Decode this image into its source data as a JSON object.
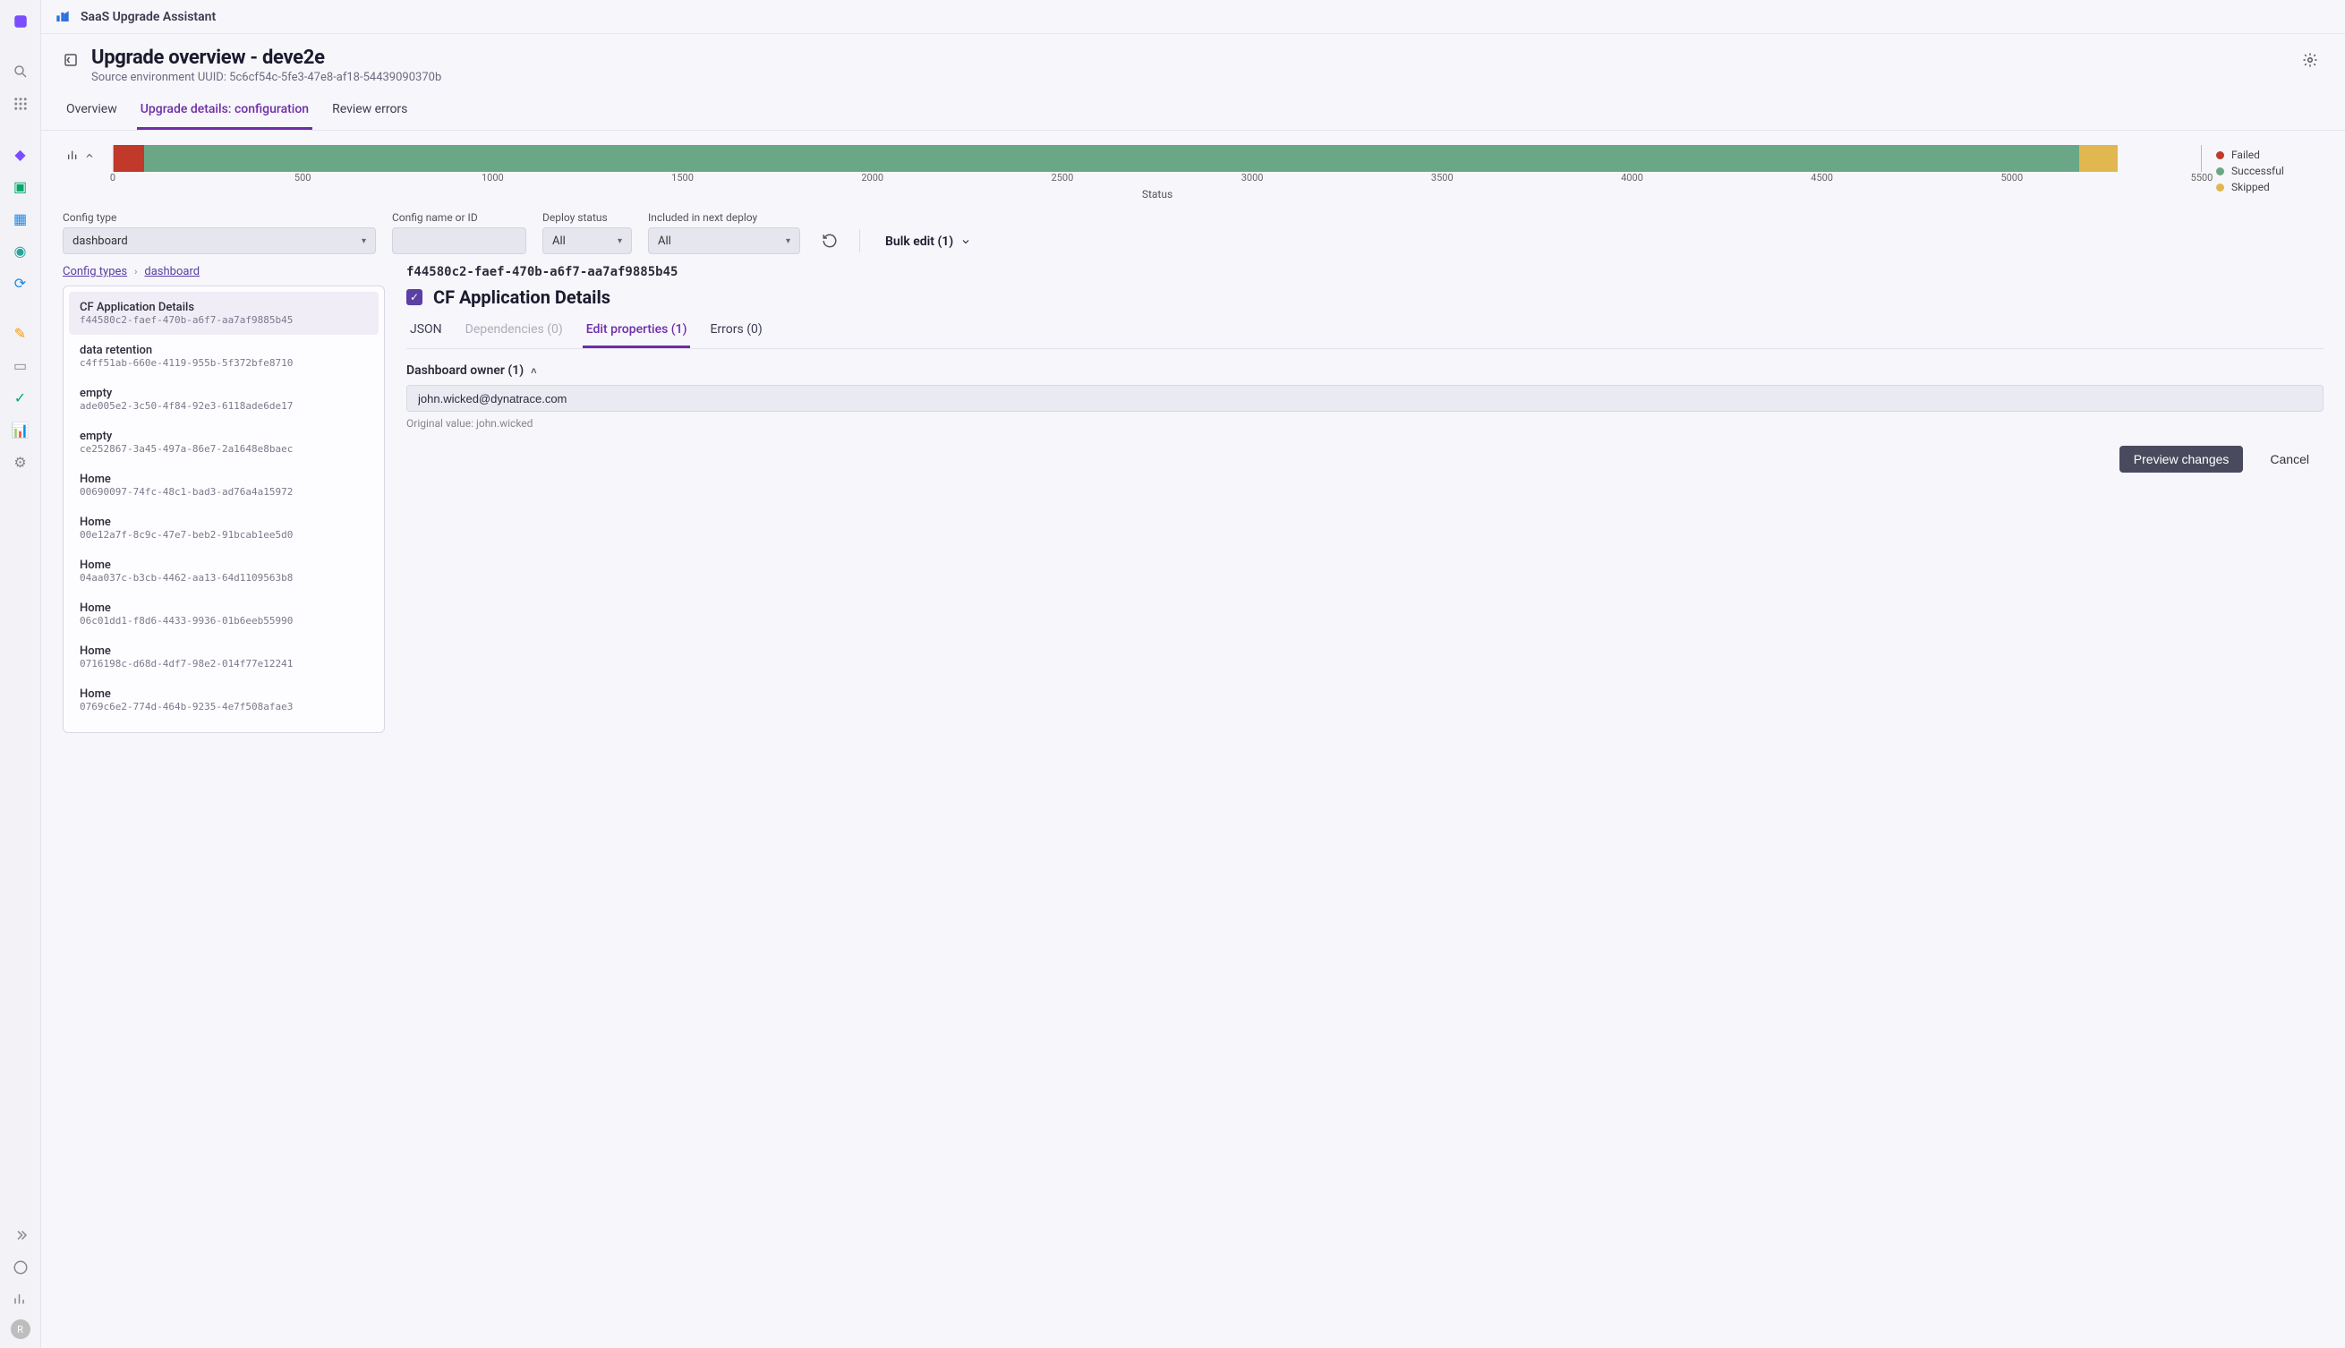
{
  "app_name": "SaaS Upgrade Assistant",
  "page_title": "Upgrade overview - deve2e",
  "page_subtitle": "Source environment UUID: 5c6cf54c-5fe3-47e8-af18-54439090370b",
  "tabs": [
    "Overview",
    "Upgrade details: configuration",
    "Review errors"
  ],
  "active_tab": 1,
  "chart_data": {
    "type": "bar",
    "orientation": "horizontal-stacked",
    "categories": [
      "Status"
    ],
    "series": [
      {
        "name": "Failed",
        "values": [
          80
        ],
        "color": "#c0392b"
      },
      {
        "name": "Successful",
        "values": [
          5100
        ],
        "color": "#6aa786"
      },
      {
        "name": "Skipped",
        "values": [
          100
        ],
        "color": "#e0b84f"
      }
    ],
    "xlim": [
      0,
      5500
    ],
    "ticks": [
      0,
      500,
      1000,
      1500,
      2000,
      2500,
      3000,
      3500,
      4000,
      4500,
      5000,
      5500
    ],
    "xlabel": "Status",
    "legend": [
      "Failed",
      "Successful",
      "Skipped"
    ]
  },
  "filters": {
    "config_type": {
      "label": "Config type",
      "value": "dashboard"
    },
    "config_name": {
      "label": "Config name or ID",
      "value": ""
    },
    "deploy_status": {
      "label": "Deploy status",
      "value": "All"
    },
    "included": {
      "label": "Included in next deploy",
      "value": "All"
    },
    "bulk_edit_label": "Bulk edit (1)"
  },
  "breadcrumb": {
    "a": "Config types",
    "b": "dashboard"
  },
  "config_items": [
    {
      "name": "CF Application Details",
      "uuid": "f44580c2-faef-470b-a6f7-aa7af9885b45"
    },
    {
      "name": "data retention",
      "uuid": "c4ff51ab-660e-4119-955b-5f372bfe8710"
    },
    {
      "name": "empty",
      "uuid": "ade005e2-3c50-4f84-92e3-6118ade6de17"
    },
    {
      "name": "empty",
      "uuid": "ce252867-3a45-497a-86e7-2a1648e8baec"
    },
    {
      "name": "Home",
      "uuid": "00690097-74fc-48c1-bad3-ad76a4a15972"
    },
    {
      "name": "Home",
      "uuid": "00e12a7f-8c9c-47e7-beb2-91bcab1ee5d0"
    },
    {
      "name": "Home",
      "uuid": "04aa037c-b3cb-4462-aa13-64d1109563b8"
    },
    {
      "name": "Home",
      "uuid": "06c01dd1-f8d6-4433-9936-01b6eeb55990"
    },
    {
      "name": "Home",
      "uuid": "0716198c-d68d-4df7-98e2-014f77e12241"
    },
    {
      "name": "Home",
      "uuid": "0769c6e2-774d-464b-9235-4e7f508afae3"
    }
  ],
  "selected_item_index": 0,
  "detail": {
    "uuid": "f44580c2-faef-470b-a6f7-aa7af9885b45",
    "title": "CF Application Details",
    "checked": true,
    "tabs": {
      "json": "JSON",
      "deps": "Dependencies (0)",
      "edit": "Edit properties (1)",
      "errors": "Errors (0)"
    },
    "active_tab": "edit",
    "property": {
      "header": "Dashboard owner (1)",
      "value": "john.wicked@dynatrace.com",
      "original_label": "Original value:",
      "original_value": "john.wicked"
    },
    "actions": {
      "preview": "Preview changes",
      "cancel": "Cancel"
    }
  },
  "rail_avatar": "R"
}
